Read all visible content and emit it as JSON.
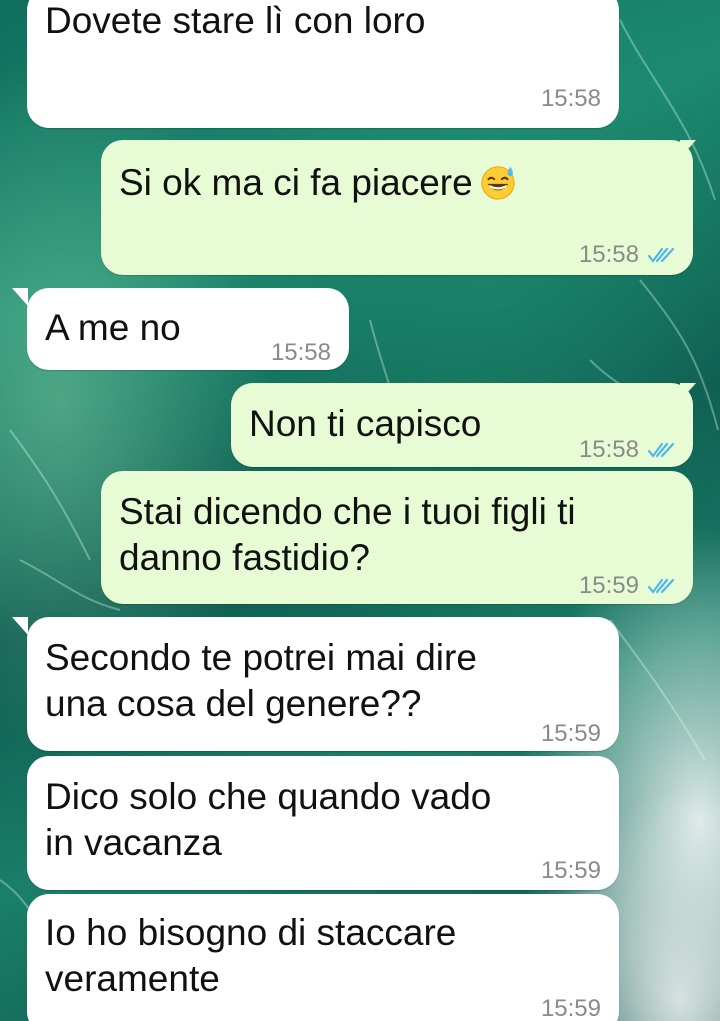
{
  "messages": [
    {
      "direction": "incoming",
      "text": "Dovete stare lì con loro",
      "time": "15:58"
    },
    {
      "direction": "outgoing",
      "text": "Si ok ma ci fa piacere",
      "emoji": "grinning-sweat-emoji",
      "time": "15:58",
      "status": "read"
    },
    {
      "direction": "incoming",
      "text": "A me no",
      "time": "15:58"
    },
    {
      "direction": "outgoing",
      "text": "Non ti capisco",
      "time": "15:58",
      "status": "read"
    },
    {
      "direction": "outgoing",
      "text": "Stai dicendo che i tuoi figli ti\ndanno fastidio?",
      "time": "15:59",
      "status": "read"
    },
    {
      "direction": "incoming",
      "text": "Secondo te potrei mai dire\nuna cosa del genere??",
      "time": "15:59"
    },
    {
      "direction": "incoming",
      "text": "Dico solo che quando vado\nin vacanza",
      "time": "15:59"
    },
    {
      "direction": "incoming",
      "text": "Io ho bisogno di staccare\nveramente",
      "time": "15:59"
    }
  ],
  "colors": {
    "incoming_bubble": "#ffffff",
    "outgoing_bubble": "#e7fcd4",
    "read_ticks": "#4fb6ec",
    "timestamp": "#8a8a8a"
  }
}
